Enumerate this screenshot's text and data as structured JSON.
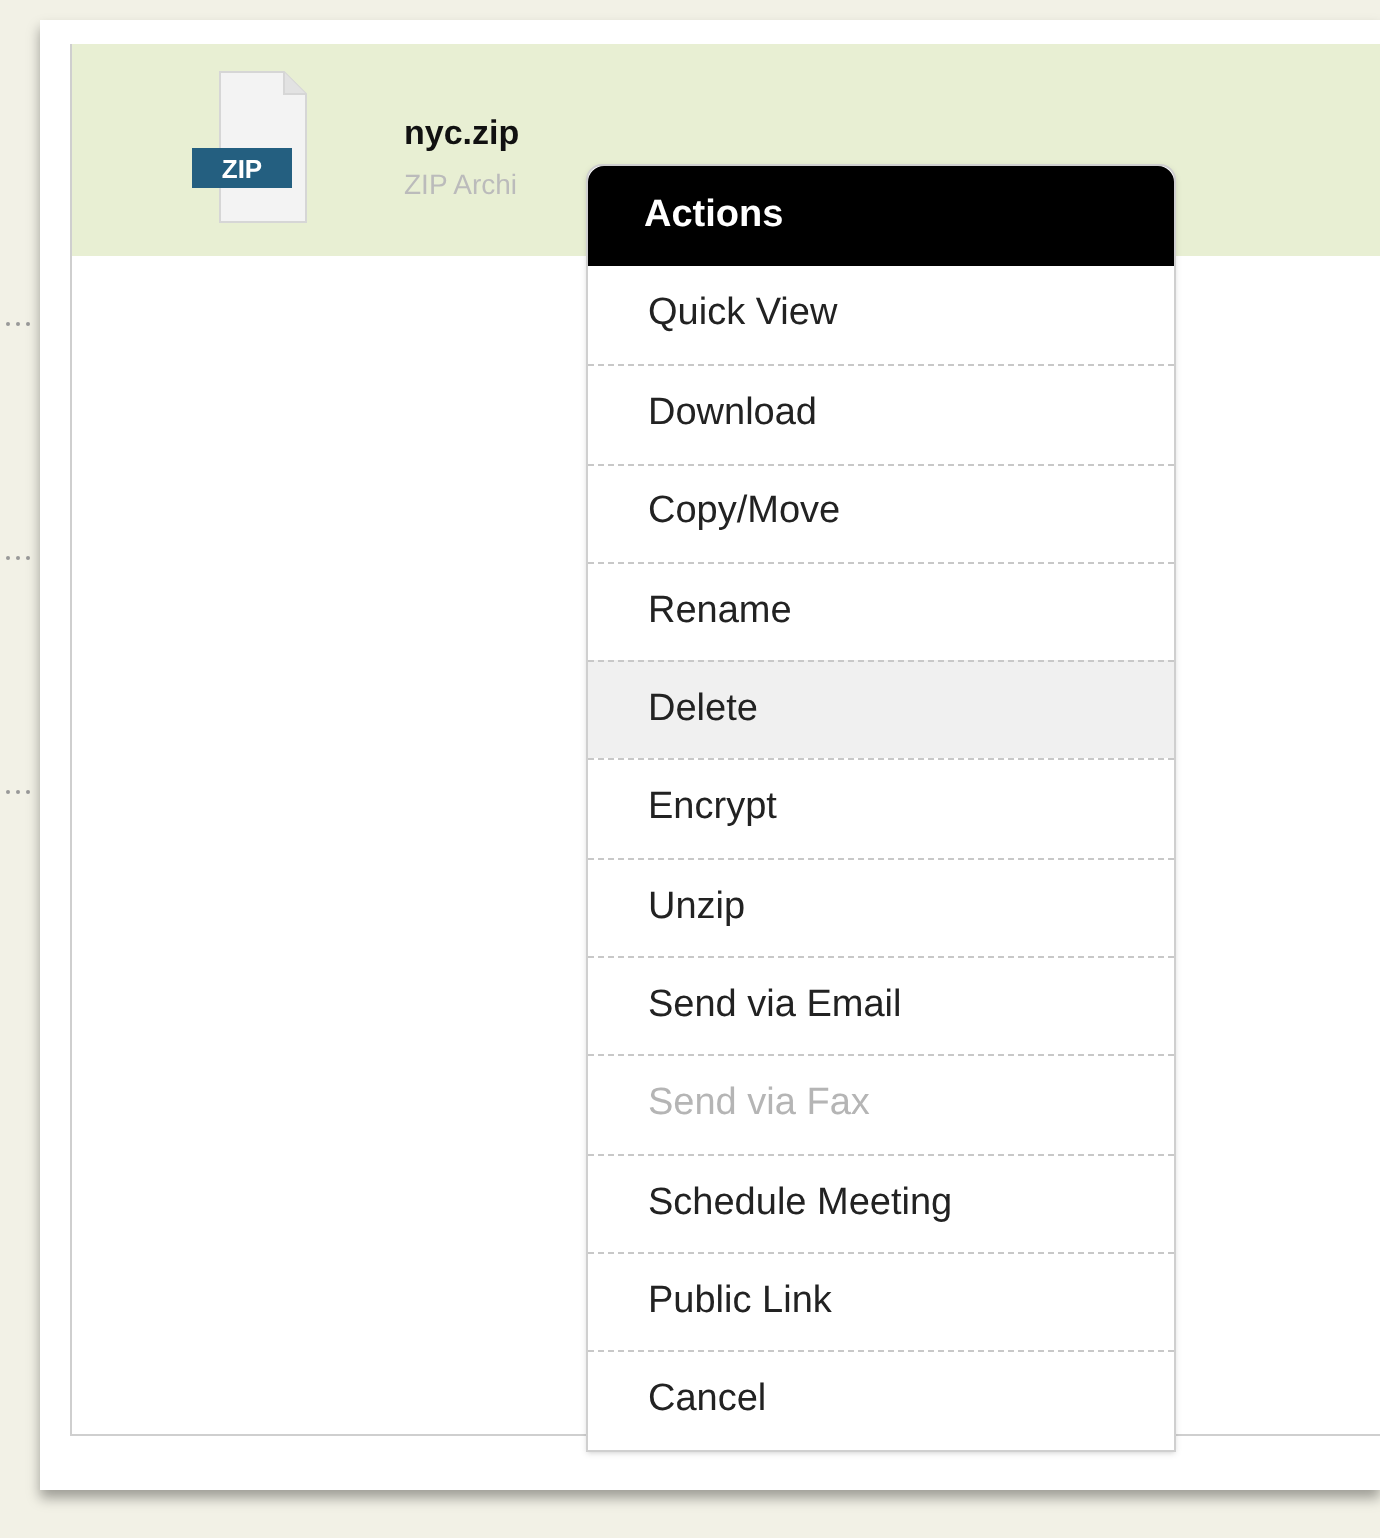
{
  "file": {
    "name": "nyc.zip",
    "type_label": "ZIP Archi",
    "icon_label": "ZIP"
  },
  "menu": {
    "title": "Actions",
    "items": [
      {
        "label": "Quick View",
        "selected": false,
        "disabled": false
      },
      {
        "label": "Download",
        "selected": false,
        "disabled": false
      },
      {
        "label": "Copy/Move",
        "selected": false,
        "disabled": false
      },
      {
        "label": "Rename",
        "selected": false,
        "disabled": false
      },
      {
        "label": "Delete",
        "selected": true,
        "disabled": false
      },
      {
        "label": "Encrypt",
        "selected": false,
        "disabled": false
      },
      {
        "label": "Unzip",
        "selected": false,
        "disabled": false
      },
      {
        "label": "Send via Email",
        "selected": false,
        "disabled": false
      },
      {
        "label": "Send via Fax",
        "selected": false,
        "disabled": true
      },
      {
        "label": "Schedule Meeting",
        "selected": false,
        "disabled": false
      },
      {
        "label": "Public Link",
        "selected": false,
        "disabled": false
      },
      {
        "label": "Cancel",
        "selected": false,
        "disabled": false
      }
    ]
  }
}
